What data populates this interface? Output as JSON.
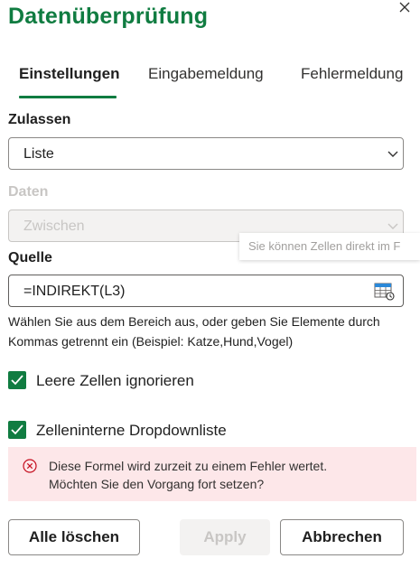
{
  "dialog": {
    "title": "Datenüberprüfung"
  },
  "tabs": [
    {
      "label": "Einstellungen",
      "active": true
    },
    {
      "label": "Eingabemeldung",
      "active": false
    },
    {
      "label": "Fehlermeldung",
      "active": false
    }
  ],
  "allow": {
    "label": "Zulassen",
    "value": "Liste"
  },
  "data_field": {
    "label": "Daten",
    "value": "Zwischen",
    "disabled": true
  },
  "source": {
    "label": "Quelle",
    "value": "=INDIREKT(L3)",
    "tooltip": "Sie können Zellen direkt im F",
    "help": "Wählen Sie aus dem Bereich aus, oder geben Sie Elemente durch Kommas getrennt ein (Beispiel: Katze,Hund,Vogel)"
  },
  "options": {
    "ignore_blank": {
      "label": "Leere Zellen ignorieren",
      "checked": true
    },
    "in_cell_dropdown": {
      "label": "Zelleninterne Dropdownliste",
      "checked": true
    }
  },
  "error": {
    "line1": "Diese Formel wird zurzeit zu einem Fehler wertet.",
    "line2": "Möchten Sie den Vorgang fort setzen?"
  },
  "buttons": {
    "clear_all": "Alle löschen",
    "apply": "Apply",
    "cancel": "Abbrechen"
  },
  "colors": {
    "accent": "#107c41",
    "error_bg": "#fde7e9",
    "error_icon": "#c50f1f"
  }
}
